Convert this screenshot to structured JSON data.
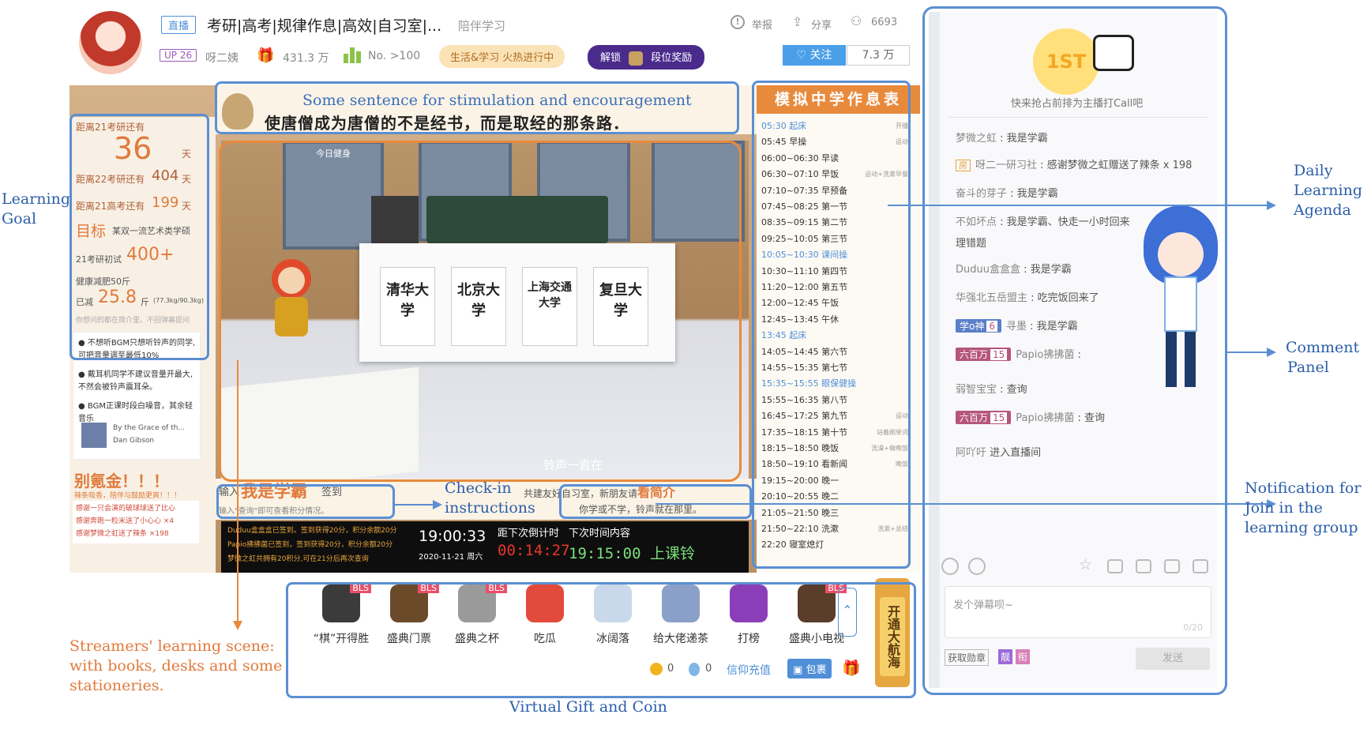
{
  "header": {
    "live_tag": "直播",
    "title": "考研|高考|规律作息|高效|自习室|...",
    "subtitle": "陪伴学习",
    "report": "举报",
    "share": "分享",
    "viewers": "6693",
    "up_level": "UP 26",
    "streamer_name": "呀二姨",
    "gift_value": "431.3 万",
    "rank": "No. >100",
    "activity": "生活&学习 火热进行中",
    "unlock": "解锁",
    "unlock_reward": "段位奖励",
    "follow": "关注",
    "follower_count": "7.3 万"
  },
  "stream": {
    "motto_en": "Some sentence for stimulation and encouragement",
    "motto_cn": "使唐僧成为唐僧的不是经书，而是取经的那条路．",
    "scene_top_label": "今日健身",
    "goals": {
      "exam21": "距离21考研还有",
      "exam21_days": "36",
      "days_unit": "天",
      "exam22": "距离22考研还有",
      "exam22_days": "404",
      "gaokao21": "距离21高考还有",
      "gaokao21_days": "199",
      "target_title": "目标",
      "target_desc": "某双一流艺术类学硕",
      "score_label": "21考研初试",
      "score_value": "400+",
      "health": "健康减肥50斤",
      "lost_label": "已减",
      "lost_value": "25.8",
      "lost_unit": "斤",
      "lost_detail": "(77.3kg/90.3kg)",
      "footer": "你想问的都在简介里。不回弹幕提问"
    },
    "tips": [
      "不想听BGM只想听铃声的同学,可把音量调至最低10%",
      "戴耳机同学不建议音量开最大,不然会被铃声震耳朵。",
      "BGM正课时段白噪音，其余轻音乐"
    ],
    "music": {
      "title": "By the Grace of th...",
      "artist": "Dan Gibson"
    },
    "cheer": "别氪金！！！",
    "cheer_sub": "辣条吸香，陪伴与鼓励更爽！！！",
    "thanks": [
      "感谢一只会演的破球球送了比心",
      "感谢奔跑一粒米送了小心心 ×4",
      "感谢梦微之虹送了辣条 ×198"
    ],
    "checkin": {
      "prefix": "输入",
      "phrase": "我是学霸",
      "suffix": "签到",
      "hint": "输入\"查询\"即可查看积分情况。"
    },
    "slogan": {
      "line1_pre": "共建友好自习室，新朋友请",
      "line1_hl": "看简介",
      "line2": "你学或不学，铃声就在那里。"
    },
    "scene_caption": "铃声一直在",
    "book_labels": [
      "清华大学",
      "北京大学",
      "上海交通大学",
      "复旦大学"
    ],
    "log": [
      "Duduu盒盒盒已签到。签到获得20分，积分余额20分",
      "Papio拂拂菌已签到，签到获得20分，积分余额20分",
      "梦微之虹共拥有20积分,可在21分后再次查询"
    ],
    "clock": {
      "time": "19:00:33",
      "date": "2020-11-21 周六"
    },
    "countdown": {
      "label": "距下次倒计时",
      "value": "00:14:27"
    },
    "next": {
      "label": "下次时间内容",
      "value": "19:15:00 上课铃"
    }
  },
  "schedule": {
    "title": "模拟中学作息表",
    "rows": [
      {
        "time": "05:30 起床",
        "note": "开播",
        "blue": true
      },
      {
        "time": "05:45 早操",
        "note": "运动",
        "blue": false
      },
      {
        "time": "06:00~06:30 早读",
        "note": "",
        "blue": false
      },
      {
        "time": "06:30~07:10 早饭",
        "note": "运动+洗漱早餐",
        "blue": false
      },
      {
        "time": "07:10~07:35 早预备",
        "note": "",
        "blue": false
      },
      {
        "time": "07:45~08:25 第一节",
        "note": "",
        "blue": false
      },
      {
        "time": "08:35~09:15 第二节",
        "note": "",
        "blue": false
      },
      {
        "time": "09:25~10:05 第三节",
        "note": "",
        "blue": false
      },
      {
        "time": "10:05~10:30 课间操",
        "note": "",
        "blue": true
      },
      {
        "time": "10:30~11:10 第四节",
        "note": "",
        "blue": false
      },
      {
        "time": "11:20~12:00 第五节",
        "note": "",
        "blue": false
      },
      {
        "time": "12:00~12:45 午饭",
        "note": "",
        "blue": false
      },
      {
        "time": "12:45~13:45 午休",
        "note": "",
        "blue": false
      },
      {
        "time": "13:45 起床",
        "note": "",
        "blue": true
      },
      {
        "time": "14:05~14:45 第六节",
        "note": "",
        "blue": false
      },
      {
        "time": "14:55~15:35 第七节",
        "note": "",
        "blue": false
      },
      {
        "time": "15:35~15:55 眼保健操",
        "note": "",
        "blue": true
      },
      {
        "time": "15:55~16:35 第八节",
        "note": "",
        "blue": false
      },
      {
        "time": "16:45~17:25 第九节",
        "note": "运动",
        "blue": false
      },
      {
        "time": "17:35~18:15 第十节",
        "note": "站着刷单词",
        "blue": false
      },
      {
        "time": "18:15~18:50 晚饭",
        "note": "洗澡+做晚饭",
        "blue": false
      },
      {
        "time": "18:50~19:10 看新闻",
        "note": "晚饭",
        "blue": false
      },
      {
        "time": "19:15~20:00 晚一",
        "note": "",
        "blue": false
      },
      {
        "time": "20:10~20:55 晚二",
        "note": "",
        "blue": false
      },
      {
        "time": "21:05~21:50 晚三",
        "note": "",
        "blue": false
      },
      {
        "time": "21:50~22:10 洗漱",
        "note": "洗漱+总结",
        "blue": false
      },
      {
        "time": "22:20 寝室熄灯",
        "note": "",
        "blue": false
      }
    ]
  },
  "gifts": {
    "items": [
      {
        "label": "“棋”开得胜",
        "bls": "BLS",
        "color": "#3b3b3b"
      },
      {
        "label": "盛典门票",
        "bls": "BLS",
        "color": "#6b4a2a"
      },
      {
        "label": "盛典之杯",
        "bls": "BLS",
        "color": "#9a9a9a"
      },
      {
        "label": "吃瓜",
        "bls": "",
        "color": "#e24b3b"
      },
      {
        "label": "冰阔落",
        "bls": "",
        "color": "#c9d8ea"
      },
      {
        "label": "给大佬递茶",
        "bls": "",
        "color": "#8aa0c8"
      },
      {
        "label": "打榜",
        "bls": "",
        "color": "#8a3fb8"
      },
      {
        "label": "盛典小电视",
        "bls": "BLS",
        "color": "#5a3d2a"
      }
    ],
    "gold": "0",
    "silver": "0",
    "recharge": "信仰充值",
    "package": "包裹",
    "navy": "开通大航海"
  },
  "comments": {
    "call_text": "快来抢占前排为主播打Call吧",
    "items": [
      {
        "user": "梦微之虹",
        "text": "我是学霸"
      },
      {
        "tag": "房",
        "user": "呀二一研习社",
        "text": "感谢梦微之虹赠送了辣条 x 198"
      },
      {
        "user": "奋斗的芽子",
        "text": "我是学霸"
      },
      {
        "user": "不如坏点",
        "text": "我是学霸、快走一小时回来",
        "text2": "理错题"
      },
      {
        "user": "Duduu盒盒盒",
        "text": "我是学霸"
      },
      {
        "user": "华强北五岳盟主",
        "text": "吃完饭回来了"
      },
      {
        "medal": "学o神",
        "medal_level": "6",
        "user": "寻墨",
        "text": "我是学霸"
      },
      {
        "medal": "六百万",
        "medal_level": "15",
        "user": "Papio拂拂菌",
        "text": ""
      },
      {
        "user": "弱智宝宝",
        "text": "查询"
      },
      {
        "medal": "六百万",
        "medal_level": "15",
        "user": "Papio拂拂菌",
        "text": "查询"
      },
      {
        "user": "阿吖吁",
        "text": "进入直播间"
      }
    ],
    "input_placeholder": "发个弹幕呗~",
    "char_count": "0/20",
    "get_medal": "获取勋章",
    "badge1": "靓",
    "badge2": "衔",
    "send": "发送"
  },
  "annotations": {
    "learning_goal": [
      "Learning",
      "Goal"
    ],
    "daily_agenda": [
      "Daily",
      "Learning",
      "Agenda"
    ],
    "comment_panel": [
      "Comment",
      "Panel"
    ],
    "notification": [
      "Notification for",
      "Join in the",
      "learning group"
    ],
    "checkin": [
      "Check-in",
      "instructions"
    ],
    "scene": [
      "Streamers' learning scene:",
      "with books, desks and some",
      "stationeries."
    ],
    "gift": "Virtual Gift and Coin"
  },
  "colors": {
    "annotation_blue": "#5b8fd2",
    "annotation_orange": "#e88a3c",
    "schedule_header": "#e88a3c"
  }
}
